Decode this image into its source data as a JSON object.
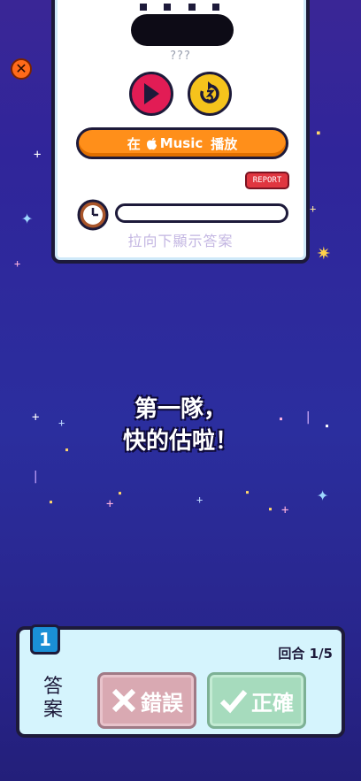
{
  "player": {
    "unknown_title": "???",
    "music_button_label": "在 Music 播放",
    "music_button_prefix": "在",
    "music_button_brand": "Music",
    "music_button_suffix": "播放",
    "report_label": "REPORT",
    "hint_text": "拉向下顯示答案",
    "timer_progress_percent": 0
  },
  "message": {
    "line1": "第一隊，",
    "line2": "快的估啦！"
  },
  "answer_panel": {
    "round_number": "1",
    "round_text": "回合 1/5",
    "answer_label": "答案",
    "wrong_label": "錯誤",
    "correct_label": "正確"
  },
  "colors": {
    "play": "#e21c55",
    "replay": "#f5c31c",
    "music": "#ff8f1a",
    "report": "#e03640",
    "badge": "#1a8fd6",
    "wrong": "#d9a9b2",
    "correct": "#a6dbbd"
  },
  "icons": [
    "close-icon",
    "play-icon",
    "replay-icon",
    "apple-icon",
    "clock-icon",
    "cross-icon",
    "check-icon"
  ]
}
